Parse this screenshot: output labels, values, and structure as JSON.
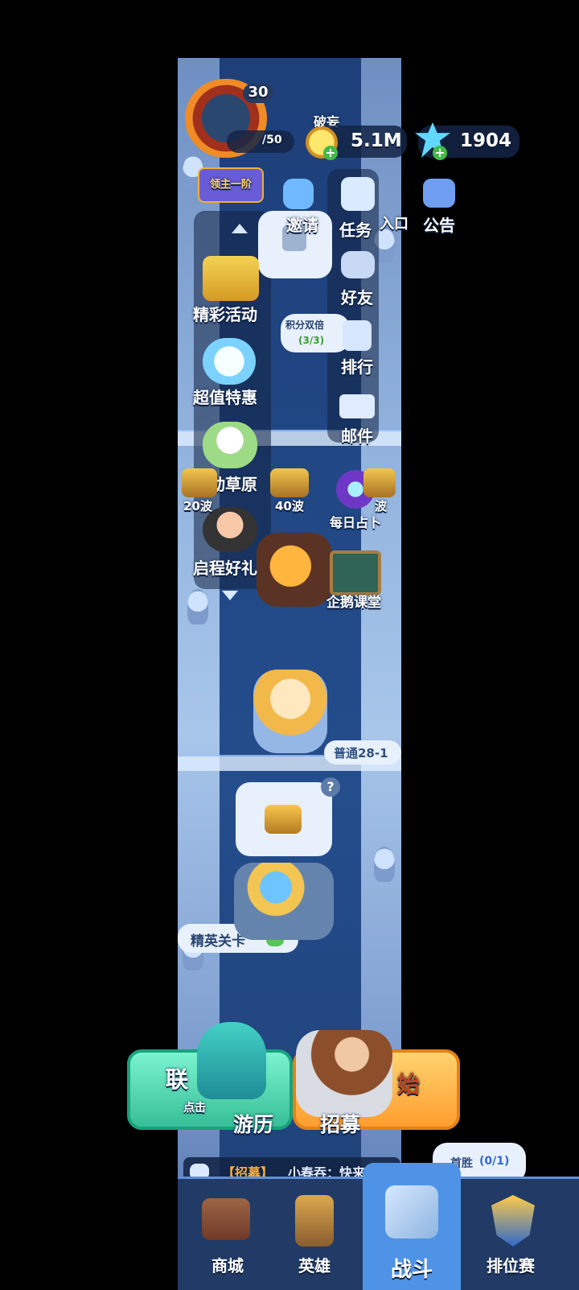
{
  "player": {
    "level": "30",
    "exp": "/50",
    "rank_badge": "领主一阶",
    "title_tag": "破妄"
  },
  "currency": {
    "gold": "5.1M",
    "gems": "1904"
  },
  "top_icons": {
    "invite": "邀请",
    "task": "任务",
    "entrance": "入口",
    "announcement": "公告"
  },
  "left_menu": {
    "events": "精彩活动",
    "bargain": "超值特惠",
    "meadow": "跃动草原",
    "journey_gift": "启程好礼"
  },
  "right_menu": {
    "friends": "好友",
    "ranking": "排行",
    "mail": "邮件",
    "daily_divination": "每日占卜",
    "penguin_class": "企鹅课堂"
  },
  "event_bubble": {
    "title": "积分双倍",
    "progress": "(3/3)"
  },
  "wave_chests": [
    "20波",
    "40波",
    "波"
  ],
  "stage": {
    "current": "普通28-1",
    "elite": "精英关卡"
  },
  "buttons": {
    "league": "联",
    "league_sub": "点击",
    "start_tail": "始",
    "travel": "游历",
    "recruit": "招募"
  },
  "chat": {
    "tag": "【招募】",
    "message": "小春吞：快来跟我"
  },
  "first_win": {
    "label": "首胜",
    "progress": "(0/1)"
  },
  "nav": {
    "shop": "商城",
    "hero": "英雄",
    "battle": "战斗",
    "ranked": "排位赛"
  },
  "colors": {
    "accent_gold": "#ffc629",
    "nav_active": "#4f93e6",
    "league_green": "#39c8a0",
    "start_orange": "#ffa23a"
  }
}
